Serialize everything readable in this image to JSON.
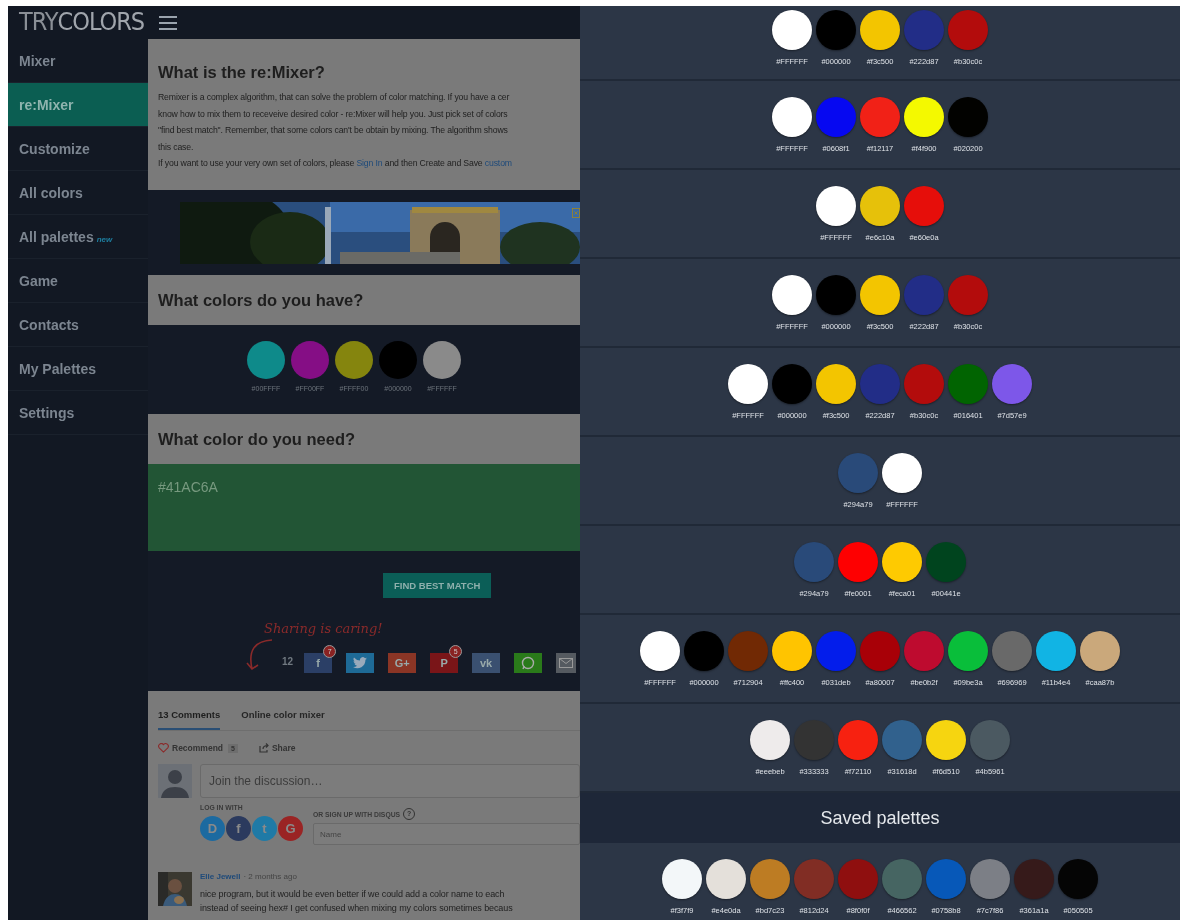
{
  "logo": "TRY**COLORS**",
  "sidebar": {
    "items": [
      {
        "label": "Mixer",
        "selected": false
      },
      {
        "label": "re:Mixer",
        "selected": true
      },
      {
        "label": "Customize",
        "selected": false
      },
      {
        "label": "All colors",
        "selected": false
      },
      {
        "label": "All palettes",
        "badge": "new",
        "selected": false
      },
      {
        "label": "Game",
        "selected": false
      },
      {
        "label": "Contacts",
        "selected": false
      },
      {
        "label": "My Palettes",
        "selected": false
      },
      {
        "label": "Settings",
        "selected": false
      }
    ]
  },
  "intro": {
    "title": "What is the re:Mixer?",
    "lines": [
      "Remixer is a complex algorithm, that can solve the problem of color matching. If you have a cer",
      "know how to mix them to receveive desired color - re:Mixer will help you. Just pick set of colors",
      "\"find best match\". Remember, that some colors can't be obtain by mixing. The algorithm shows",
      "this case."
    ],
    "last_line": {
      "before": "If you want to use your very own set of colors, please ",
      "link": "Sign In",
      "middle": " and then Create and Save ",
      "link2": "custom"
    }
  },
  "have": {
    "title": "What colors do you have?",
    "colors": [
      {
        "color": "#0e8a8a",
        "label": "#00FFFF"
      },
      {
        "color": "#850e85",
        "label": "#FF00FF"
      },
      {
        "color": "#85850e",
        "label": "#FFFF00"
      },
      {
        "color": "#000000",
        "label": "#000000"
      },
      {
        "color": "#8a8a8a",
        "label": "#FFFFFF"
      }
    ]
  },
  "need": {
    "title": "What color do you need?",
    "value": "#41AC6A",
    "color": "#225535"
  },
  "find_button": "FIND BEST MATCH",
  "share": {
    "tagline": "Sharing is caring!",
    "count": "12",
    "buttons": [
      {
        "kind": "facebook",
        "glyph": "f",
        "color": "#2b3f66",
        "badge": "7"
      },
      {
        "kind": "twitter",
        "color": "#1e6a96"
      },
      {
        "kind": "google",
        "glyph": "G+",
        "color": "#8a3525"
      },
      {
        "kind": "pinterest",
        "glyph": "P",
        "color": "#7a1518",
        "badge": "5"
      },
      {
        "kind": "vk",
        "glyph": "vk",
        "color": "#3a5070"
      },
      {
        "kind": "whatsapp",
        "color": "#2a7a1a"
      },
      {
        "kind": "email",
        "color": "#555a60"
      }
    ]
  },
  "comments": {
    "tabs": [
      {
        "label": "13 Comments",
        "selected": true
      },
      {
        "label": "Online color mixer",
        "selected": false
      }
    ],
    "recommend": "Recommend",
    "recommend_count": "5",
    "share": "Share",
    "placeholder": "Join the discussion…",
    "login_label": "LOG IN WITH",
    "logins": [
      {
        "glyph": "D",
        "color": "#1c6aa0"
      },
      {
        "glyph": "f",
        "color": "#2b3a5e"
      },
      {
        "glyph": "t",
        "color": "#1f7aa6"
      },
      {
        "glyph": "G",
        "color": "#9a2424"
      }
    ],
    "signup_label": "OR SIGN UP WITH DISQUS",
    "help": "?",
    "name_placeholder": "Name",
    "comment": {
      "author": "Elle Jewell",
      "time": "· 2 months ago",
      "lines": [
        "nice program, but it would be even better if we could add a color name to each",
        "instead of seeing hex# I get confused when mixing my colors sometimes becaus"
      ]
    }
  },
  "palettes": [
    {
      "colors": [
        {
          "color": "#ffffff",
          "label": "#FFFFFF"
        },
        {
          "color": "#000000",
          "label": "#000000"
        },
        {
          "color": "#f3c500",
          "label": "#f3c500"
        },
        {
          "color": "#222d87",
          "label": "#222d87"
        },
        {
          "color": "#b30c0c",
          "label": "#b30c0c"
        }
      ]
    },
    {
      "colors": [
        {
          "color": "#ffffff",
          "label": "#FFFFFF"
        },
        {
          "color": "#0608f1",
          "label": "#0608f1"
        },
        {
          "color": "#f12117",
          "label": "#f12117"
        },
        {
          "color": "#f4f900",
          "label": "#f4f900"
        },
        {
          "color": "#020200",
          "label": "#020200"
        }
      ]
    },
    {
      "colors": [
        {
          "color": "#ffffff",
          "label": "#FFFFFF"
        },
        {
          "color": "#e6c10a",
          "label": "#e6c10a"
        },
        {
          "color": "#e60e0a",
          "label": "#e60e0a"
        }
      ]
    },
    {
      "colors": [
        {
          "color": "#ffffff",
          "label": "#FFFFFF"
        },
        {
          "color": "#000000",
          "label": "#000000"
        },
        {
          "color": "#f3c500",
          "label": "#f3c500"
        },
        {
          "color": "#222d87",
          "label": "#222d87"
        },
        {
          "color": "#b30c0c",
          "label": "#b30c0c"
        }
      ]
    },
    {
      "colors": [
        {
          "color": "#ffffff",
          "label": "#FFFFFF"
        },
        {
          "color": "#000000",
          "label": "#000000"
        },
        {
          "color": "#f3c500",
          "label": "#f3c500"
        },
        {
          "color": "#222d87",
          "label": "#222d87"
        },
        {
          "color": "#b30c0c",
          "label": "#b30c0c"
        },
        {
          "color": "#016401",
          "label": "#016401"
        },
        {
          "color": "#7d57e9",
          "label": "#7d57e9"
        }
      ]
    },
    {
      "colors": [
        {
          "color": "#294a79",
          "label": "#294a79"
        },
        {
          "color": "#ffffff",
          "label": "#FFFFFF"
        }
      ]
    },
    {
      "colors": [
        {
          "color": "#294a79",
          "label": "#294a79"
        },
        {
          "color": "#fe0001",
          "label": "#fe0001"
        },
        {
          "color": "#feca01",
          "label": "#feca01"
        },
        {
          "color": "#00441e",
          "label": "#00441e"
        }
      ]
    },
    {
      "colors": [
        {
          "color": "#ffffff",
          "label": "#FFFFFF"
        },
        {
          "color": "#000000",
          "label": "#000000"
        },
        {
          "color": "#712904",
          "label": "#712904"
        },
        {
          "color": "#ffc400",
          "label": "#ffc400"
        },
        {
          "color": "#031deb",
          "label": "#031deb"
        },
        {
          "color": "#a80007",
          "label": "#a80007"
        },
        {
          "color": "#be0b2f",
          "label": "#be0b2f"
        },
        {
          "color": "#09be3a",
          "label": "#09be3a"
        },
        {
          "color": "#696969",
          "label": "#696969"
        },
        {
          "color": "#11b4e4",
          "label": "#11b4e4"
        },
        {
          "color": "#caa87b",
          "label": "#caa87b"
        }
      ]
    },
    {
      "colors": [
        {
          "color": "#eeebeb",
          "label": "#eeebeb"
        },
        {
          "color": "#333333",
          "label": "#333333"
        },
        {
          "color": "#f72110",
          "label": "#f72110"
        },
        {
          "color": "#31618d",
          "label": "#31618d"
        },
        {
          "color": "#f6d510",
          "label": "#f6d510"
        },
        {
          "color": "#4b5961",
          "label": "#4b5961"
        }
      ]
    }
  ],
  "saved_title": "Saved palettes",
  "saved": [
    {
      "colors": [
        {
          "color": "#f3f7f9",
          "label": "#f3f7f9"
        },
        {
          "color": "#e4e0da",
          "label": "#e4e0da"
        },
        {
          "color": "#bd7c23",
          "label": "#bd7c23"
        },
        {
          "color": "#812d24",
          "label": "#812d24"
        },
        {
          "color": "#8f0f0f",
          "label": "#8f0f0f"
        },
        {
          "color": "#466562",
          "label": "#466562"
        },
        {
          "color": "#0758b8",
          "label": "#0758b8"
        },
        {
          "color": "#7c7f86",
          "label": "#7c7f86"
        },
        {
          "color": "#361a1a",
          "label": "#361a1a"
        },
        {
          "color": "#050505",
          "label": "#050505"
        }
      ]
    }
  ]
}
